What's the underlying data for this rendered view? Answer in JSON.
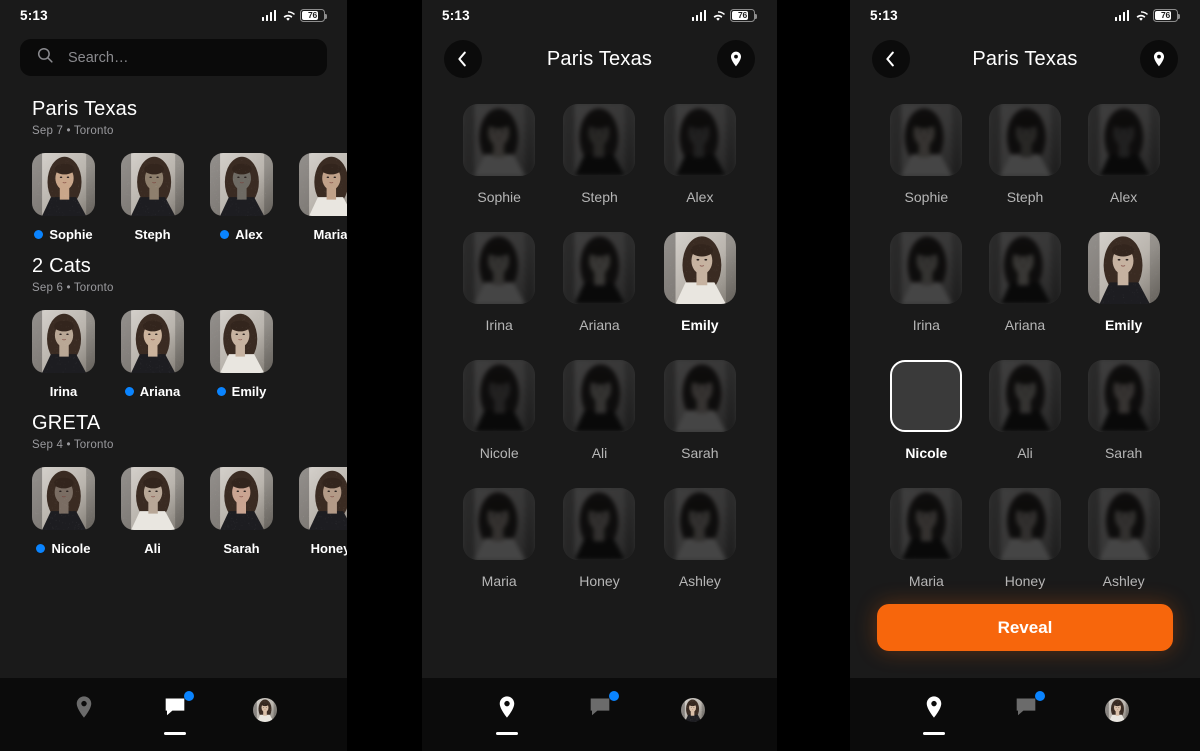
{
  "status_bar": {
    "time": "5:13",
    "battery_pct": "76",
    "wifi_icon": "wifi-icon",
    "cellular_icon": "cellular-bars-icon"
  },
  "panel1": {
    "search": {
      "placeholder": "Search…",
      "icon": "search-icon"
    },
    "sections": [
      {
        "title": "Paris Texas",
        "subtitle": "Sep 7 • Toronto",
        "people": [
          {
            "name": "Sophie",
            "dot": true,
            "tone": "#c9a68a"
          },
          {
            "name": "Steph",
            "dot": false,
            "tone": "#8e7f6d"
          },
          {
            "name": "Alex",
            "dot": true,
            "tone": "#6e6a63"
          },
          {
            "name": "Maria",
            "dot": false,
            "tone": "#c0a189"
          }
        ]
      },
      {
        "title": "2 Cats",
        "subtitle": "Sep 6 • Toronto",
        "people": [
          {
            "name": "Irina",
            "dot": false,
            "tone": "#b9a795"
          },
          {
            "name": "Ariana",
            "dot": true,
            "tone": "#cbb39c"
          },
          {
            "name": "Emily",
            "dot": true,
            "tone": "#c6b2a0"
          }
        ]
      },
      {
        "title": "GRETA",
        "subtitle": "Sep 4 • Toronto",
        "people": [
          {
            "name": "Nicole",
            "dot": true,
            "tone": "#7a6d63"
          },
          {
            "name": "Ali",
            "dot": false,
            "tone": "#b8a797"
          },
          {
            "name": "Sarah",
            "dot": false,
            "tone": "#caa491"
          },
          {
            "name": "Honey",
            "dot": false,
            "tone": "#b39a87"
          }
        ]
      }
    ],
    "tabbar": {
      "tabs": [
        {
          "icon": "location-pin-icon",
          "active": false,
          "badge": false
        },
        {
          "icon": "chat-bubble-icon",
          "active": true,
          "badge": true
        },
        {
          "icon": "profile-avatar-icon",
          "active": false,
          "badge": false
        }
      ]
    }
  },
  "panel2": {
    "nav": {
      "back_icon": "chevron-left-icon",
      "title": "Paris Texas",
      "action_icon": "location-pin-icon"
    },
    "people": [
      {
        "name": "Sophie",
        "revealed": false,
        "selected": false,
        "tone": "#c9a68a"
      },
      {
        "name": "Steph",
        "revealed": false,
        "selected": false,
        "tone": "#8e7f6d"
      },
      {
        "name": "Alex",
        "revealed": false,
        "selected": false,
        "tone": "#6e6a63"
      },
      {
        "name": "Irina",
        "revealed": false,
        "selected": false,
        "tone": "#b9a795"
      },
      {
        "name": "Ariana",
        "revealed": false,
        "selected": false,
        "tone": "#cbb39c"
      },
      {
        "name": "Emily",
        "revealed": true,
        "selected": true,
        "tone": "#c6b2a0"
      },
      {
        "name": "Nicole",
        "revealed": false,
        "selected": false,
        "tone": "#7a6d63"
      },
      {
        "name": "Ali",
        "revealed": false,
        "selected": false,
        "tone": "#b8a797"
      },
      {
        "name": "Sarah",
        "revealed": false,
        "selected": false,
        "tone": "#caa491"
      },
      {
        "name": "Maria",
        "revealed": false,
        "selected": false,
        "tone": "#c0a189"
      },
      {
        "name": "Honey",
        "revealed": false,
        "selected": false,
        "tone": "#b39a87"
      },
      {
        "name": "Ashley",
        "revealed": false,
        "selected": false,
        "tone": "#b59d8b"
      }
    ],
    "tabbar": {
      "tabs": [
        {
          "icon": "location-pin-icon",
          "active": true,
          "badge": false
        },
        {
          "icon": "chat-bubble-icon",
          "active": false,
          "badge": true
        },
        {
          "icon": "profile-avatar-icon",
          "active": false,
          "badge": false
        }
      ]
    }
  },
  "panel3": {
    "nav": {
      "back_icon": "chevron-left-icon",
      "title": "Paris Texas",
      "action_icon": "location-pin-icon"
    },
    "people": [
      {
        "name": "Sophie",
        "revealed": false,
        "selected": false,
        "empty": false,
        "tone": "#c9a68a"
      },
      {
        "name": "Steph",
        "revealed": false,
        "selected": false,
        "empty": false,
        "tone": "#8e7f6d"
      },
      {
        "name": "Alex",
        "revealed": false,
        "selected": false,
        "empty": false,
        "tone": "#6e6a63"
      },
      {
        "name": "Irina",
        "revealed": false,
        "selected": false,
        "empty": false,
        "tone": "#b9a795"
      },
      {
        "name": "Ariana",
        "revealed": false,
        "selected": false,
        "empty": false,
        "tone": "#cbb39c"
      },
      {
        "name": "Emily",
        "revealed": true,
        "selected": true,
        "empty": false,
        "tone": "#c6b2a0"
      },
      {
        "name": "Nicole",
        "revealed": false,
        "selected": true,
        "empty": true,
        "tone": "#7a6d63"
      },
      {
        "name": "Ali",
        "revealed": false,
        "selected": false,
        "empty": false,
        "tone": "#b8a797"
      },
      {
        "name": "Sarah",
        "revealed": false,
        "selected": false,
        "empty": false,
        "tone": "#caa491"
      },
      {
        "name": "Maria",
        "revealed": false,
        "selected": false,
        "empty": false,
        "tone": "#c0a189"
      },
      {
        "name": "Honey",
        "revealed": false,
        "selected": false,
        "empty": false,
        "tone": "#b39a87"
      },
      {
        "name": "Ashley",
        "revealed": false,
        "selected": false,
        "empty": false,
        "tone": "#b59d8b"
      }
    ],
    "reveal_button": {
      "label": "Reveal",
      "color": "#f7660c"
    },
    "tabbar": {
      "tabs": [
        {
          "icon": "location-pin-icon",
          "active": true,
          "badge": false
        },
        {
          "icon": "chat-bubble-icon",
          "active": false,
          "badge": true
        },
        {
          "icon": "profile-avatar-icon",
          "active": false,
          "badge": false
        }
      ]
    }
  }
}
